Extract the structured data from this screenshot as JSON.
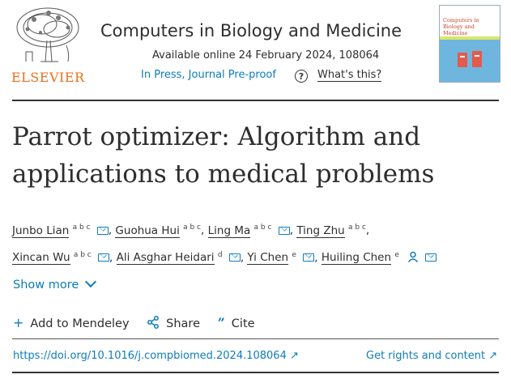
{
  "publisher": {
    "wordmark": "ELSEVIER"
  },
  "journal": {
    "title": "Computers in Biology and Medicine",
    "availability": "Available online 24 February 2024, 108064",
    "status": "In Press, Journal Pre-proof",
    "whats_this": "What's this?",
    "cover_title": "Computers in Biology and Medicine"
  },
  "article": {
    "title": "Parrot optimizer: Algorithm and applications to medical problems",
    "authors": [
      {
        "name": "Junbo Lian",
        "aff": "a b c",
        "email": true
      },
      {
        "name": "Guohua Hui",
        "aff": "a b c",
        "email": false
      },
      {
        "name": "Ling Ma",
        "aff": "a b c",
        "email": true
      },
      {
        "name": "Ting Zhu",
        "aff": "a b c",
        "email": false
      },
      {
        "name": "Xincan Wu",
        "aff": "a b c",
        "email": true
      },
      {
        "name": "Ali Asghar Heidari",
        "aff": "d",
        "email": true
      },
      {
        "name": "Yi Chen",
        "aff": "e",
        "email": true
      },
      {
        "name": "Huiling Chen",
        "aff": "e",
        "email": true,
        "corresponding": true
      }
    ],
    "show_more": "Show more",
    "actions": {
      "mendeley": "Add to Mendeley",
      "share": "Share",
      "cite": "Cite"
    },
    "doi": "https://doi.org/10.1016/j.compbiomed.2024.108064 ↗",
    "rights": "Get rights and content ↗"
  },
  "colors": {
    "accent": "#0c7dbb",
    "elsevier_orange": "#e9711c"
  }
}
